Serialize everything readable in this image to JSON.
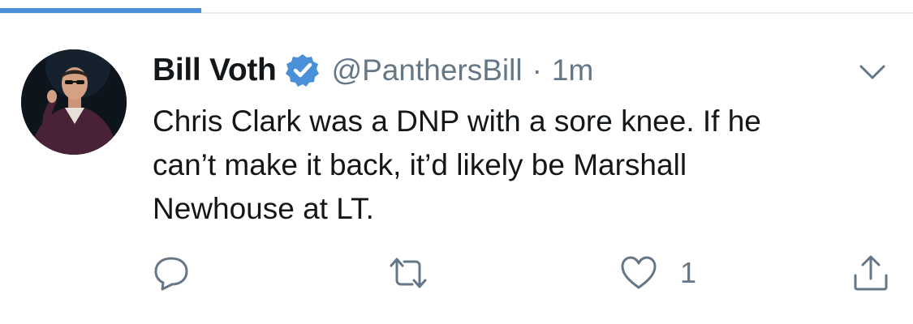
{
  "tabs": {
    "active_accent": "#4a90d9"
  },
  "tweet": {
    "display_name": "Bill Voth",
    "handle": "@PanthersBill",
    "separator": "·",
    "timestamp": "1m",
    "verified": true,
    "text_lines": [
      "Chris Clark was a DNP with a sore knee. If he",
      "can’t make it back, it’d likely be Marshall",
      "Newhouse at LT."
    ],
    "caret_icon": "chevron-down-icon"
  },
  "actions": {
    "reply_icon": "reply-icon",
    "retweet_icon": "retweet-icon",
    "like_icon": "heart-icon",
    "like_count": "1",
    "share_icon": "share-icon"
  },
  "colors": {
    "verified_blue": "#4a90d9",
    "text_primary": "#14171a",
    "text_secondary": "#657786"
  }
}
